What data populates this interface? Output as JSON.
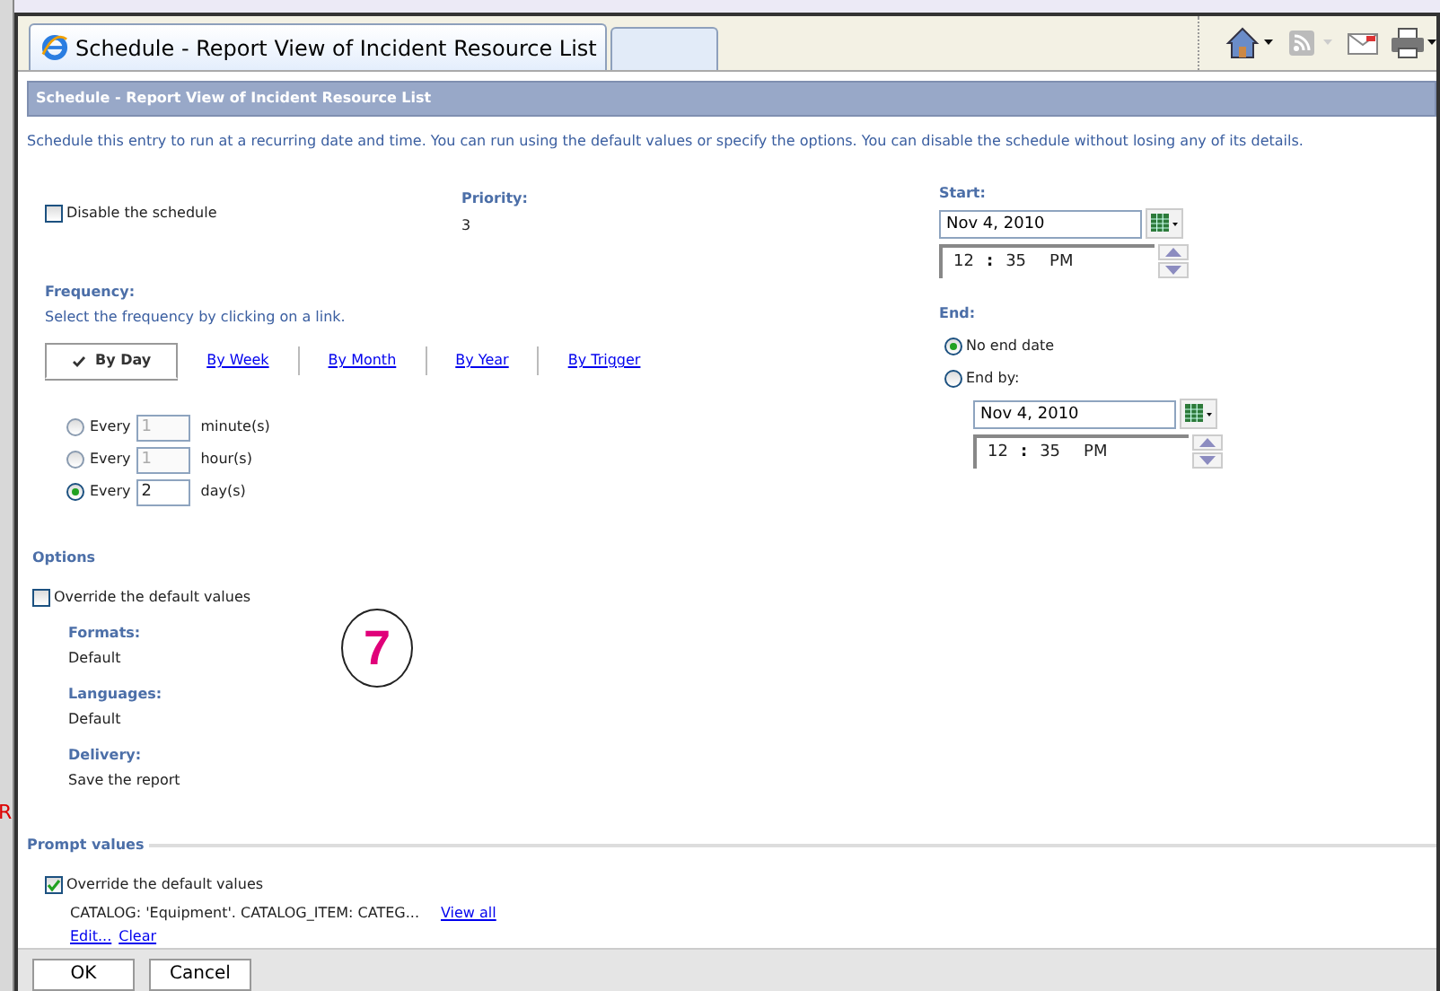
{
  "browser": {
    "tab": {
      "title": "Schedule - Report View of Incident Resource List",
      "selected": true
    }
  },
  "background_fragment": "R",
  "dialog": {
    "title": "Schedule - Report View of Incident Resource List",
    "description": "Schedule this entry to run at a recurring date and time. You can run using the default values or specify the options. You can disable the schedule without losing any of its details."
  },
  "disable_schedule": {
    "label": "Disable the schedule",
    "checked": false
  },
  "priority": {
    "label": "Priority:",
    "value": "3"
  },
  "frequency": {
    "label": "Frequency:",
    "hint": "Select the frequency by clicking on a link.",
    "tabs": [
      {
        "label": "By Day",
        "selected": true
      },
      {
        "label": "By Week",
        "selected": false
      },
      {
        "label": "By Month",
        "selected": false
      },
      {
        "label": "By Year",
        "selected": false
      },
      {
        "label": "By Trigger",
        "selected": false
      }
    ],
    "intervals": [
      {
        "label": "Every",
        "value": "1",
        "unit": "minute(s)",
        "selected": false,
        "disabled": true
      },
      {
        "label": "Every",
        "value": "1",
        "unit": "hour(s)",
        "selected": false,
        "disabled": true
      },
      {
        "label": "Every",
        "value": "2",
        "unit": "day(s)",
        "selected": true,
        "disabled": false
      }
    ]
  },
  "start": {
    "label": "Start:",
    "date": "Nov 4, 2010",
    "time": {
      "hour": "12",
      "separator": ":",
      "minute": "35",
      "period": "PM"
    }
  },
  "end": {
    "label": "End:",
    "options": [
      {
        "label": "No end date",
        "selected": true
      },
      {
        "label": "End by:",
        "selected": false
      }
    ],
    "date": "Nov 4, 2010",
    "time": {
      "hour": "12",
      "separator": ":",
      "minute": "35",
      "period": "PM"
    }
  },
  "options": {
    "label": "Options",
    "override": {
      "label": "Override the default values",
      "checked": false
    },
    "items": [
      {
        "label": "Formats:",
        "value": "Default"
      },
      {
        "label": "Languages:",
        "value": "Default"
      },
      {
        "label": "Delivery:",
        "value": "Save the report"
      }
    ]
  },
  "annotation": "7",
  "prompt_values": {
    "label": "Prompt values",
    "override": {
      "label": "Override the default values",
      "checked": true
    },
    "summary": "CATALOG: 'Equipment'. CATALOG_ITEM: CATEG...",
    "view_all": "View all",
    "actions": [
      "Edit...",
      "Clear"
    ]
  },
  "buttons": [
    "OK",
    "Cancel"
  ]
}
